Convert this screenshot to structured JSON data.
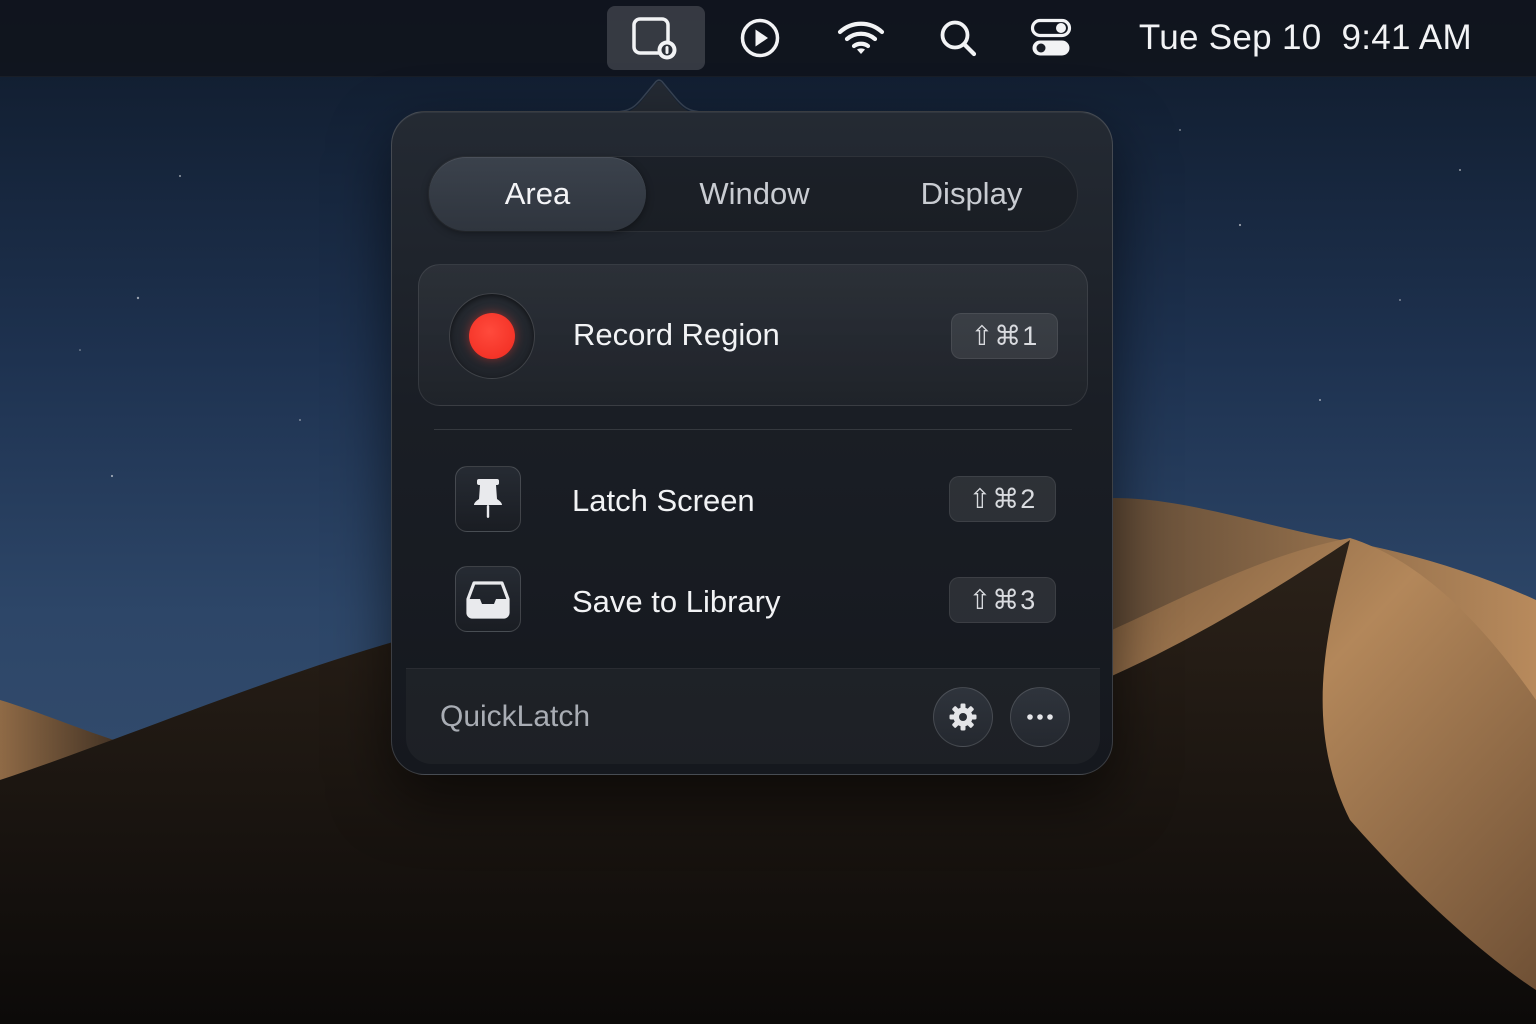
{
  "menubar": {
    "items": [
      {
        "name": "screen-record-menu-icon"
      },
      {
        "name": "play-icon"
      },
      {
        "name": "wifi-icon"
      },
      {
        "name": "search-icon"
      },
      {
        "name": "control-center-icon"
      }
    ],
    "date": "Tue Sep 10",
    "time": "9:41 AM"
  },
  "popover": {
    "segments": [
      {
        "label": "Area",
        "selected": true
      },
      {
        "label": "Window",
        "selected": false
      },
      {
        "label": "Display",
        "selected": false
      }
    ],
    "primary_action": {
      "label": "Record Region",
      "shortcut": "⇧⌘1",
      "icon": "record-icon",
      "icon_color": "#ff3b30"
    },
    "actions": [
      {
        "label": "Latch Screen",
        "shortcut": "⇧⌘2",
        "icon": "pin-icon"
      },
      {
        "label": "Save to Library",
        "shortcut": "⇧⌘3",
        "icon": "tray-icon"
      }
    ],
    "footer": {
      "app_name": "QuickLatch",
      "buttons": [
        {
          "icon": "gear-icon"
        },
        {
          "icon": "ellipsis-icon"
        }
      ]
    }
  }
}
